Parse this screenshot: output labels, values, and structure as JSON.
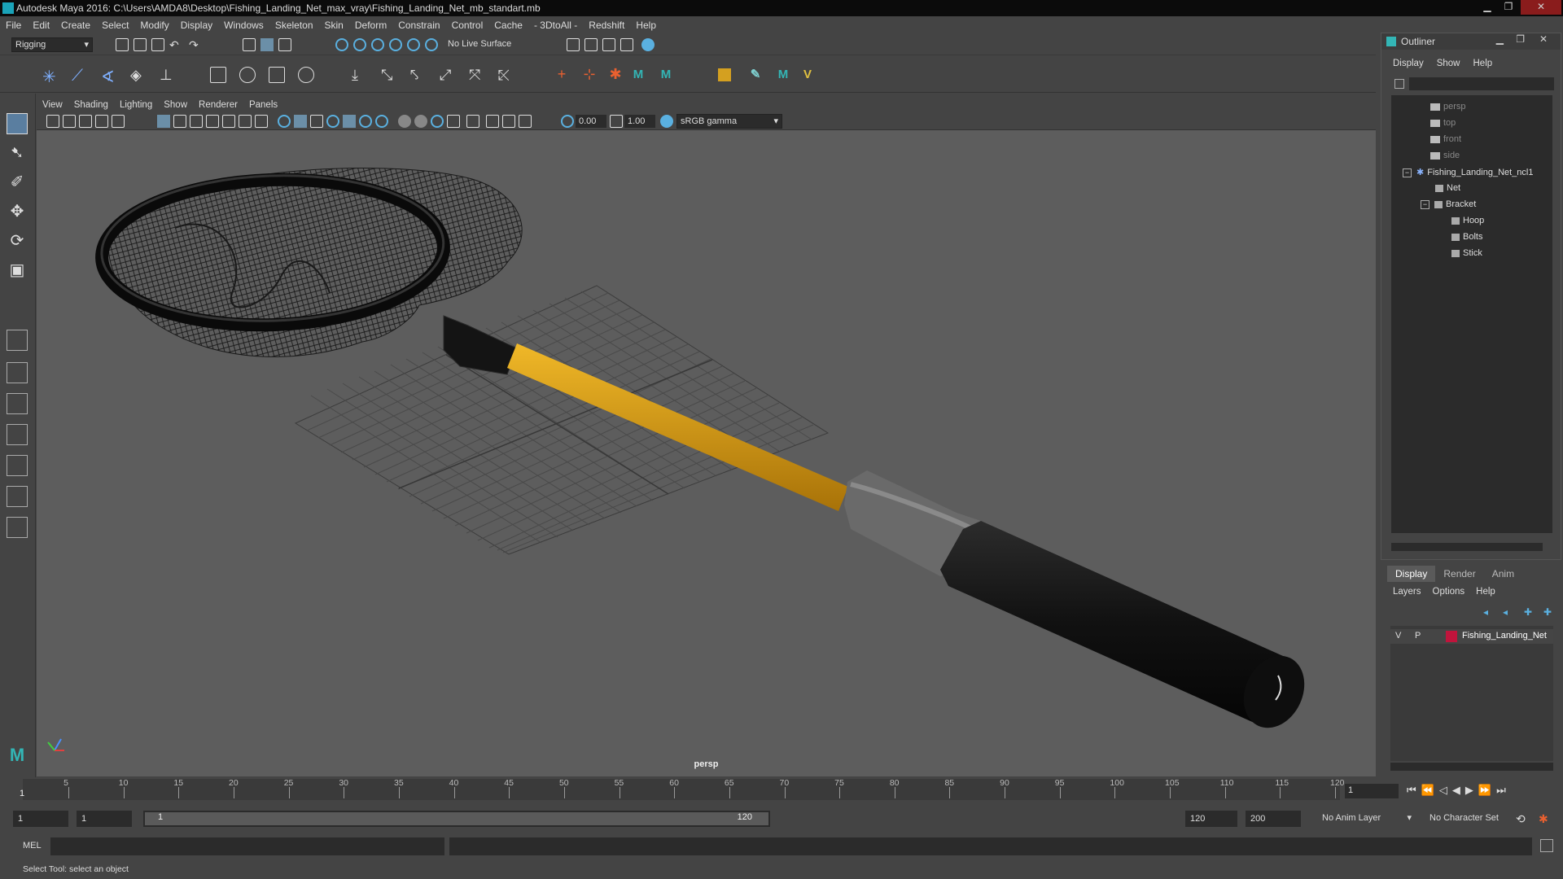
{
  "window": {
    "title": "Autodesk Maya 2016: C:\\Users\\AMDA8\\Desktop\\Fishing_Landing_Net_max_vray\\Fishing_Landing_Net_mb_standart.mb"
  },
  "menubar": [
    "File",
    "Edit",
    "Create",
    "Select",
    "Modify",
    "Display",
    "Windows",
    "Skeleton",
    "Skin",
    "Deform",
    "Constrain",
    "Control",
    "Cache",
    "- 3DtoAll -",
    "Redshift",
    "Help"
  ],
  "status_line": {
    "mode": "Rigging",
    "live_surface": "No Live Surface"
  },
  "panel": {
    "menus": [
      "View",
      "Shading",
      "Lighting",
      "Show",
      "Renderer",
      "Panels"
    ],
    "near_value": "0.00",
    "far_value": "1.00",
    "color_space": "sRGB gamma",
    "camera_label": "persp"
  },
  "outliner": {
    "title": "Outliner",
    "menus": [
      "Display",
      "Show",
      "Help"
    ],
    "items": [
      {
        "label": "persp",
        "type": "camera",
        "dim": true
      },
      {
        "label": "top",
        "type": "camera",
        "dim": true
      },
      {
        "label": "front",
        "type": "camera",
        "dim": true
      },
      {
        "label": "side",
        "type": "camera",
        "dim": true
      },
      {
        "label": "Fishing_Landing_Net_ncl1",
        "type": "group"
      },
      {
        "label": "Net",
        "type": "mesh"
      },
      {
        "label": "Bracket",
        "type": "group"
      },
      {
        "label": "Hoop",
        "type": "mesh"
      },
      {
        "label": "Bolts",
        "type": "mesh"
      },
      {
        "label": "Stick",
        "type": "mesh"
      }
    ]
  },
  "layers": {
    "tabs": [
      "Display",
      "Render",
      "Anim"
    ],
    "active_tab": "Display",
    "menus": [
      "Layers",
      "Options",
      "Help"
    ],
    "rows": [
      {
        "v": "V",
        "p": "P",
        "color": "#c0143c",
        "name": "Fishing_Landing_Net"
      }
    ]
  },
  "timeline": {
    "ticks": [
      "5",
      "10",
      "15",
      "20",
      "25",
      "30",
      "35",
      "40",
      "45",
      "50",
      "55",
      "60",
      "65",
      "70",
      "75",
      "80",
      "85",
      "90",
      "95",
      "100",
      "105",
      "110",
      "115",
      "120"
    ],
    "start_label": "1",
    "current_frame": "1"
  },
  "range": {
    "start": "1",
    "start2": "1",
    "slider_start": "1",
    "slider_end": "120",
    "end": "120",
    "end2": "200",
    "anim_layer": "No Anim Layer",
    "char_set": "No Character Set"
  },
  "command": {
    "lang": "MEL"
  },
  "help_line": "Select Tool: select an object"
}
